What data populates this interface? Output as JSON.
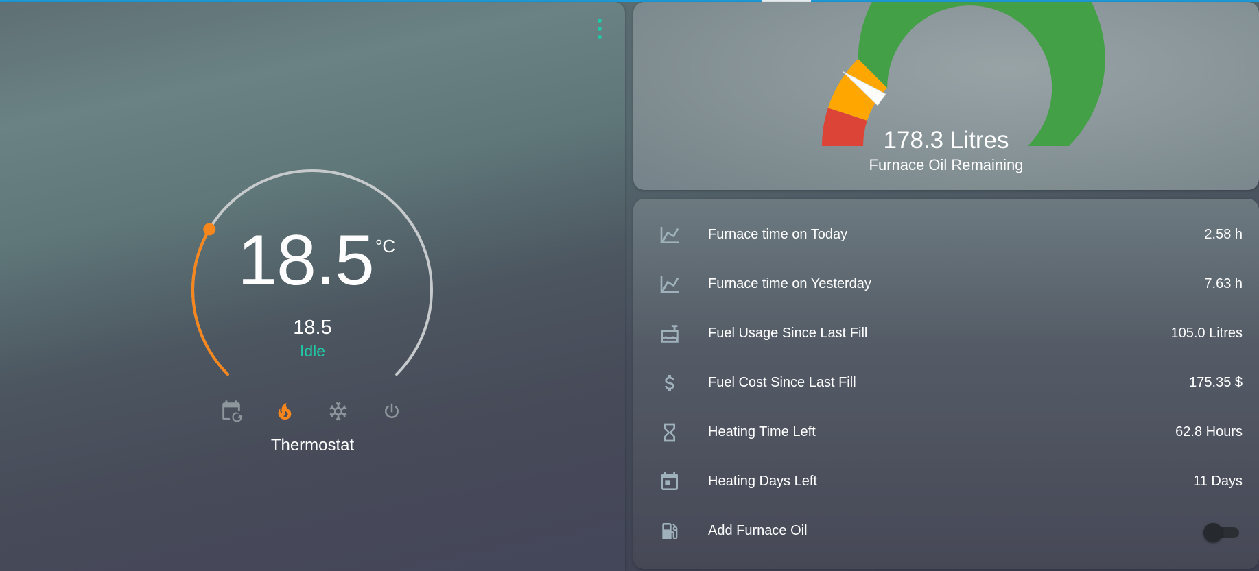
{
  "thermostat": {
    "name": "Thermostat",
    "current_temperature": "18.5",
    "unit": "°C",
    "target_temperature": "18.5",
    "hvac_action": "Idle",
    "dial_setpoint_fraction": 0.28,
    "modes": [
      {
        "name": "auto",
        "icon": "calendar-sync-icon",
        "active": false
      },
      {
        "name": "heat",
        "icon": "fire-icon",
        "active": true
      },
      {
        "name": "cool",
        "icon": "snowflake-icon",
        "active": false
      },
      {
        "name": "off",
        "icon": "power-icon",
        "active": false
      }
    ],
    "colors": {
      "heat": "#f7861c",
      "idle_text": "#20c9a6",
      "track": "#c7cacc"
    }
  },
  "gauge": {
    "value_text": "178.3 Litres",
    "label": "Furnace Oil Remaining",
    "value_fraction": 0.2,
    "segments": [
      {
        "from": 0.0,
        "to": 0.1,
        "color": "#db4437"
      },
      {
        "from": 0.1,
        "to": 0.25,
        "color": "#ffa600"
      },
      {
        "from": 0.25,
        "to": 1.0,
        "color": "#43a047"
      }
    ]
  },
  "entities": [
    {
      "icon": "chart-line-icon",
      "name": "Furnace time on Today",
      "value": "2.58 h"
    },
    {
      "icon": "chart-line-icon",
      "name": "Furnace time on Yesterday",
      "value": "7.63 h"
    },
    {
      "icon": "oil-tank-icon",
      "name": "Fuel Usage Since Last Fill",
      "value": "105.0 Litres"
    },
    {
      "icon": "currency-usd-icon",
      "name": "Fuel Cost Since Last Fill",
      "value": "175.35 $"
    },
    {
      "icon": "hourglass-icon",
      "name": "Heating Time Left",
      "value": "62.8 Hours"
    },
    {
      "icon": "calendar-icon",
      "name": "Heating Days Left",
      "value": "11 Days"
    },
    {
      "icon": "gas-station-icon",
      "name": "Add Furnace Oil",
      "toggle_on": false
    }
  ]
}
